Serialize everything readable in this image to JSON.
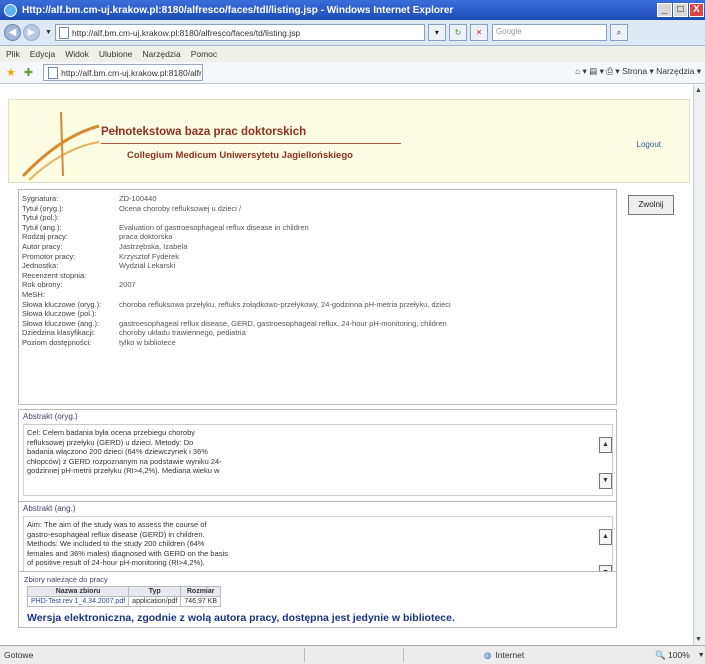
{
  "window": {
    "title": "Http://alf.bm.cm-uj.krakow.pl:8180/alfresco/faces/tdl/listing.jsp - Windows Internet Explorer",
    "min": "_",
    "max": "□",
    "close": "X"
  },
  "address": {
    "url": "http://alf.bm.cm-uj.krakow.pl:8180/alfresco/faces/td/listing.jsp",
    "search_placeholder": "Google"
  },
  "menu": [
    "Plik",
    "Edycja",
    "Widok",
    "Ulubione",
    "Narzędzia",
    "Pomoc"
  ],
  "favorites": {
    "tab_label": "http://alf.bm.cm-uj.krakow.pl:8180/alfres...",
    "tools": "Strona ▾   Narzędzia ▾"
  },
  "banner": {
    "title": "Pełnotekstowa baza prac doktorskich",
    "subtitle": "Collegium Medicum Uniwersytetu Jagiellońskiego",
    "logout": "Logout"
  },
  "record": {
    "return_button": "Zwolnij",
    "fields": [
      {
        "label": "Sygnatura:",
        "value": "ZD-100440"
      },
      {
        "label": "Tytuł (oryg.):",
        "value": "Ocena choroby refluksowej u dzieci /"
      },
      {
        "label": "Tytuł (pol.):",
        "value": ""
      },
      {
        "label": "Tytuł (ang.):",
        "value": "Evaluation of gastroesophageal reflux disease in children"
      },
      {
        "label": "Rodzaj pracy:",
        "value": "praca doktorska"
      },
      {
        "label": "Autor pracy:",
        "value": "Jastrzębska, Izabela"
      },
      {
        "label": "Promotor pracy:",
        "value": "Krzysztof Fyderek"
      },
      {
        "label": "Jednostka:",
        "value": "Wydział Lekarski"
      },
      {
        "label": "Recenzent stopnia:",
        "value": ""
      },
      {
        "label": "Rok obrony:",
        "value": "2007"
      },
      {
        "label": "MeSH:",
        "value": ""
      },
      {
        "label": "Słowa kluczowe (oryg.):",
        "value": "choroba refluksowa przełyku, refluks żołądkowo-przełykowy, 24-godzinna pH-metria przełyku, dzieci"
      },
      {
        "label": "Słowa kluczowe (pol.):",
        "value": ""
      },
      {
        "label": "Słowa kluczowe (ang.):",
        "value": "gastroesophageal reflux disease, GERD, gastroesophageal reflux, 24-hour pH-monitoring, children"
      },
      {
        "label": "Dziedzina klasyfikacji:",
        "value": "choroby układu trawiennego, pediatria"
      },
      {
        "label": "Poziom dostępności:",
        "value": "tylko w bibliotece"
      }
    ]
  },
  "abstract_pl": {
    "title": "Abstrakt (oryg.)",
    "lines": [
      "Cel: Celem badania była ocena przebiegu choroby",
      "refluksowej przełyku (GERD) u dzieci. Metody: Do",
      "badania włączono 200 dzieci (64% dziewczynek i 36%",
      "chłopców) z GERD rozpoznanym na podstawie wyniku 24-",
      "godzinnej pH-metrii przełyku (RI>4,2%). Mediana wieku w"
    ]
  },
  "abstract_en": {
    "title": "Abstrakt (ang.)",
    "lines": [
      "Aim: The aim of the study was to assess the course of",
      "gastro-esophageal reflux disease (GERD) in children.",
      "Methods: We included to the study 200 children (64%",
      "females and 36% males) diagnosed with GERD on the basis",
      "of positive result of 24-hour pH-monitoring (RI>4,2%)."
    ]
  },
  "files": {
    "title": "Zbiory należące do pracy",
    "columns": [
      "Nazwa zbioru",
      "Typ",
      "Rozmiar"
    ],
    "rows": [
      [
        "PHD-Test rev 1_4.34.2007.pdf",
        "application/pdf",
        "746,97 KB"
      ]
    ],
    "notice": "Wersja elektroniczna, zgodnie z wolą autora pracy, dostępna jest jedynie w bibliotece."
  },
  "status": {
    "left": "Gotowe",
    "zone": "Internet",
    "zoom": "100%"
  }
}
